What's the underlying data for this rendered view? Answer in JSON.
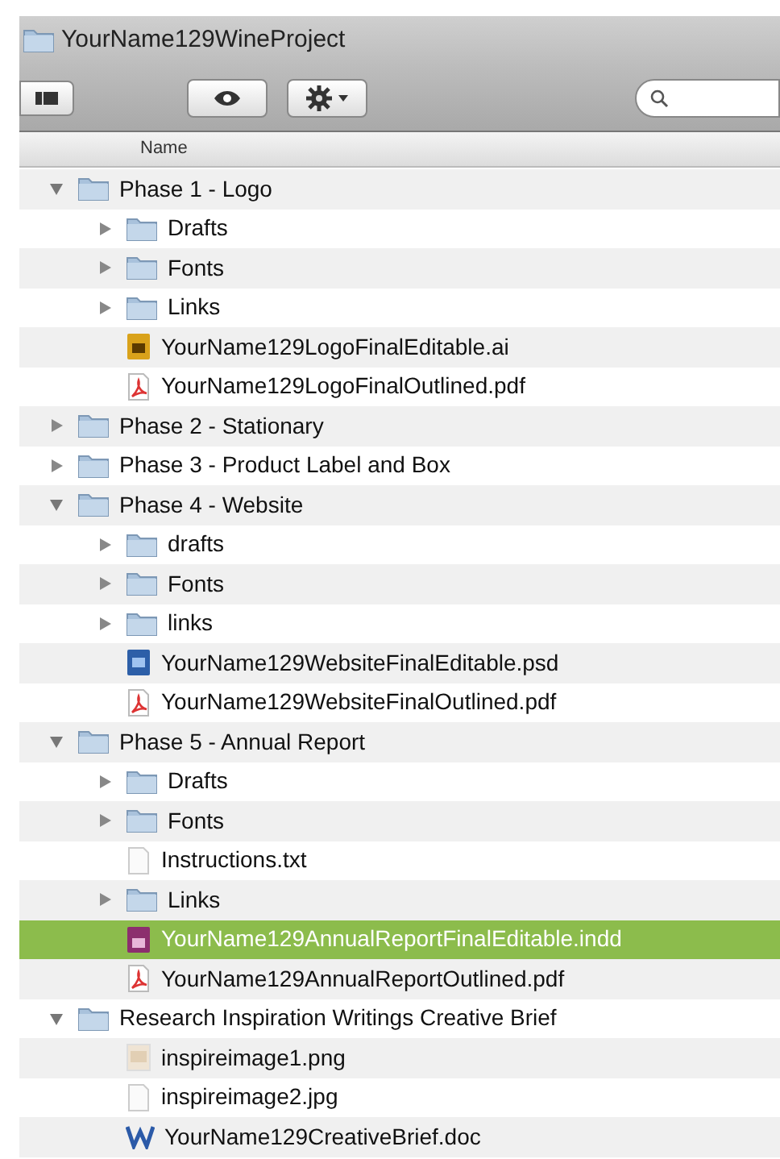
{
  "window": {
    "title": "YourName129WineProject"
  },
  "list_header": {
    "label": "Name"
  },
  "tree": [
    {
      "name": "Phase 1 - Logo",
      "kind": "folder",
      "expanded": true,
      "selected": false,
      "children": [
        {
          "name": "Drafts",
          "kind": "folder",
          "expanded": false,
          "selected": false
        },
        {
          "name": "Fonts",
          "kind": "folder",
          "expanded": false,
          "selected": false
        },
        {
          "name": "Links",
          "kind": "folder",
          "expanded": false,
          "selected": false
        },
        {
          "name": "YourName129LogoFinalEditable.ai",
          "kind": "ai",
          "selected": false
        },
        {
          "name": "YourName129LogoFinalOutlined.pdf",
          "kind": "pdf",
          "selected": false
        }
      ]
    },
    {
      "name": "Phase 2 - Stationary",
      "kind": "folder",
      "expanded": false,
      "selected": false
    },
    {
      "name": "Phase 3 - Product Label and Box",
      "kind": "folder",
      "expanded": false,
      "selected": false
    },
    {
      "name": "Phase 4 - Website",
      "kind": "folder",
      "expanded": true,
      "selected": false,
      "children": [
        {
          "name": "drafts",
          "kind": "folder",
          "expanded": false,
          "selected": false
        },
        {
          "name": "Fonts",
          "kind": "folder",
          "expanded": false,
          "selected": false
        },
        {
          "name": "links",
          "kind": "folder",
          "expanded": false,
          "selected": false
        },
        {
          "name": "YourName129WebsiteFinalEditable.psd",
          "kind": "psd",
          "selected": false
        },
        {
          "name": "YourName129WebsiteFinalOutlined.pdf",
          "kind": "pdf",
          "selected": false
        }
      ]
    },
    {
      "name": "Phase 5 - Annual Report",
      "kind": "folder",
      "expanded": true,
      "selected": false,
      "children": [
        {
          "name": "Drafts",
          "kind": "folder",
          "expanded": false,
          "selected": false
        },
        {
          "name": "Fonts",
          "kind": "folder",
          "expanded": false,
          "selected": false
        },
        {
          "name": "Instructions.txt",
          "kind": "txt",
          "selected": false
        },
        {
          "name": "Links",
          "kind": "folder",
          "expanded": false,
          "selected": false
        },
        {
          "name": "YourName129AnnualReportFinalEditable.indd",
          "kind": "indd",
          "selected": true
        },
        {
          "name": "YourName129AnnualReportOutlined.pdf",
          "kind": "pdf",
          "selected": false
        }
      ]
    },
    {
      "name": "Research Inspiration Writings Creative Brief",
      "kind": "folder",
      "expanded": true,
      "selected": false,
      "children": [
        {
          "name": "inspireimage1.png",
          "kind": "png",
          "selected": false
        },
        {
          "name": "inspireimage2.jpg",
          "kind": "jpg",
          "selected": false
        },
        {
          "name": "YourName129CreativeBrief.doc",
          "kind": "doc",
          "selected": false
        }
      ]
    }
  ]
}
